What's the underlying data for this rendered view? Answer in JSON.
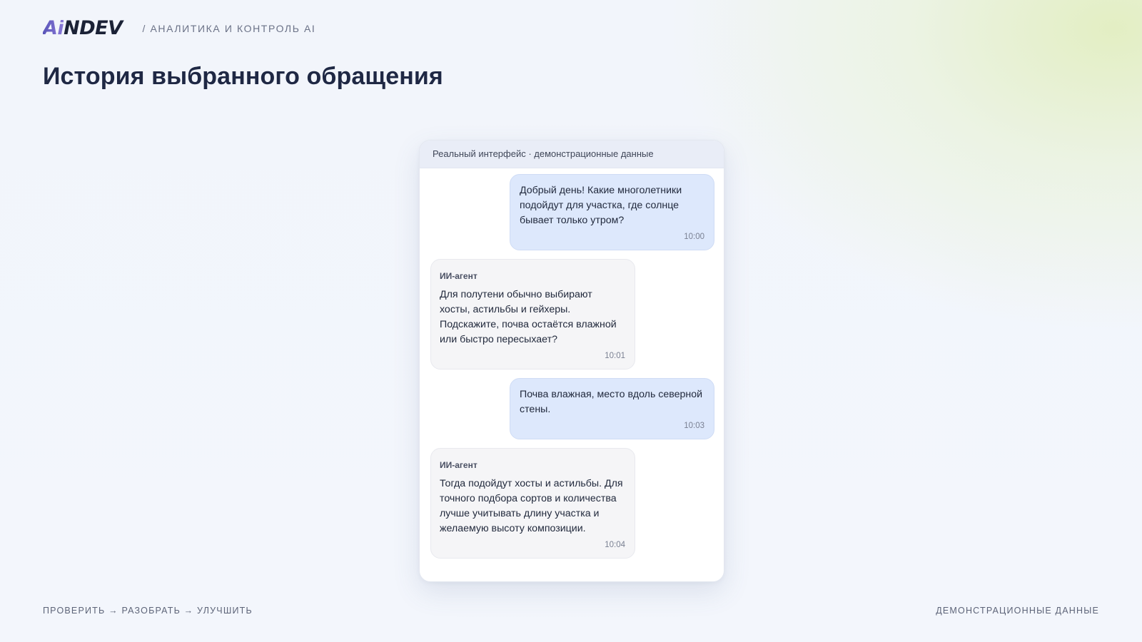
{
  "header": {
    "logo_ai": "Ai",
    "logo_rest": "NDEV",
    "tagline": "/ АНАЛИТИКА И КОНТРОЛЬ AI",
    "title": "История выбранного обращения"
  },
  "chat": {
    "header_label": "Реальный интерфейс · демонстрационные данные",
    "messages": [
      {
        "role": "user",
        "text": "Добрый день! Какие многолетники подойдут для участка, где солнце бывает только утром?",
        "time": "10:00"
      },
      {
        "role": "agent",
        "sender": "ИИ-агент",
        "text": "Для полутени обычно выбирают хосты, астильбы и гейхеры. Подскажите, почва остаётся влажной или быстро пересыхает?",
        "time": "10:01"
      },
      {
        "role": "user",
        "text": "Почва влажная, место вдоль северной стены.",
        "time": "10:03"
      },
      {
        "role": "agent",
        "sender": "ИИ-агент",
        "text": "Тогда подойдут хосты и астильбы. Для точного подбора сортов и количества лучше учитывать длину участка и желаемую высоту композиции.",
        "time": "10:04"
      }
    ]
  },
  "footer": {
    "left": "ПРОВЕРИТЬ → РАЗОБРАТЬ → УЛУЧШИТЬ",
    "right": "ДЕМОНСТРАЦИОННЫЕ ДАННЫЕ"
  },
  "colors": {
    "user_bubble": "#dde8fc",
    "agent_bubble": "#f5f5f7",
    "title_text": "#1f2844",
    "logo_accent": "#6a61c9"
  }
}
